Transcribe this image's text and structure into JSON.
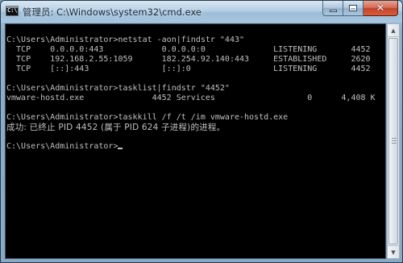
{
  "window": {
    "title": "管理员: C:\\Windows\\system32\\cmd.exe",
    "icon_label": "C:\\",
    "controls": {
      "minimize": "minimize-icon",
      "maximize": "maximize-icon",
      "close": "close-icon"
    }
  },
  "console": {
    "lines": [
      "",
      "C:\\Users\\Administrator>netstat -aon|findstr \"443\"",
      "  TCP    0.0.0.0:443            0.0.0.0:0              LISTENING       4452",
      "  TCP    192.168.2.55:1059      182.254.92.140:443     ESTABLISHED     2620",
      "  TCP    [::]:443               [::]:0                 LISTENING       4452",
      "",
      "C:\\Users\\Administrator>tasklist|findstr \"4452\"",
      "vmware-hostd.exe              4452 Services                   0      4,408 K",
      "",
      "C:\\Users\\Administrator>taskkill /f /t /im vmware-hostd.exe"
    ],
    "success_message": "成功: 已终止 PID 4452 (属于 PID 624 子进程)的进程。",
    "prompt": "C:\\Users\\Administrator>"
  },
  "colors": {
    "console_bg": "#000000",
    "console_text": "#c0c0c0",
    "close_button": "#c4432a"
  }
}
